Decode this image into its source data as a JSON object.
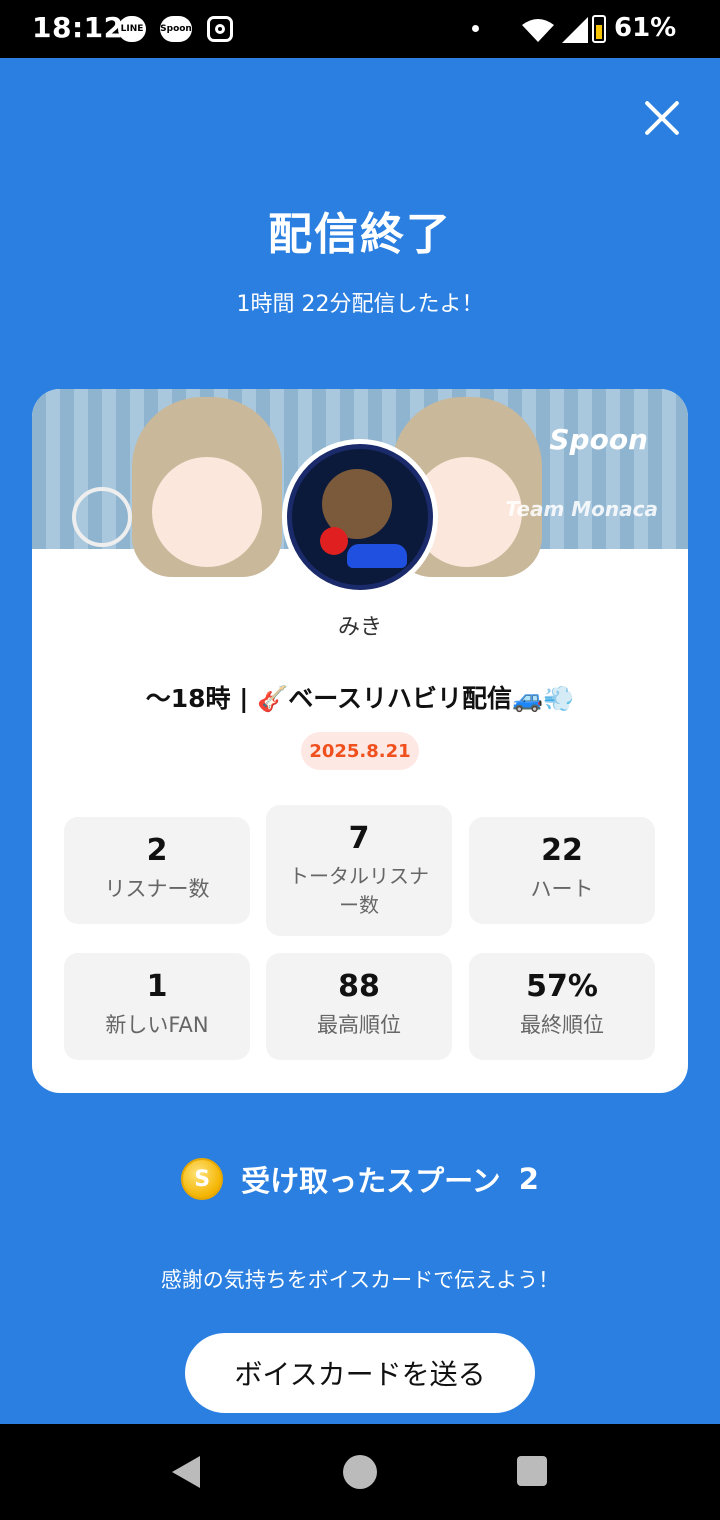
{
  "status_bar": {
    "time": "18:12",
    "battery": "61%",
    "apps": [
      "LINE",
      "Spoon"
    ]
  },
  "header": {
    "title": "配信終了",
    "subtitle": "1時間 22分配信したよ！"
  },
  "card": {
    "banner_logo": "Spoon",
    "banner_team": "Team Monaca",
    "username": "みき",
    "live_title": "～18時 | 🎸ベースリハビリ配信🚙💨",
    "date": "2025.8.21",
    "stats": [
      {
        "value": "2",
        "label": "リスナー数"
      },
      {
        "value": "7",
        "label": "トータルリスナー数"
      },
      {
        "value": "22",
        "label": "ハート"
      },
      {
        "value": "1",
        "label": "新しいFAN"
      },
      {
        "value": "88",
        "label": "最高順位"
      },
      {
        "value": "57%",
        "label": "最終順位"
      }
    ]
  },
  "spoons": {
    "coin_symbol": "S",
    "label": "受け取ったスプーン",
    "count": "2"
  },
  "footer": {
    "message": "感謝の気持ちをボイスカードで伝えよう！",
    "button_label": "ボイスカードを送る"
  },
  "colors": {
    "background": "#2a7fe0",
    "accent_date": "#f0501e"
  }
}
